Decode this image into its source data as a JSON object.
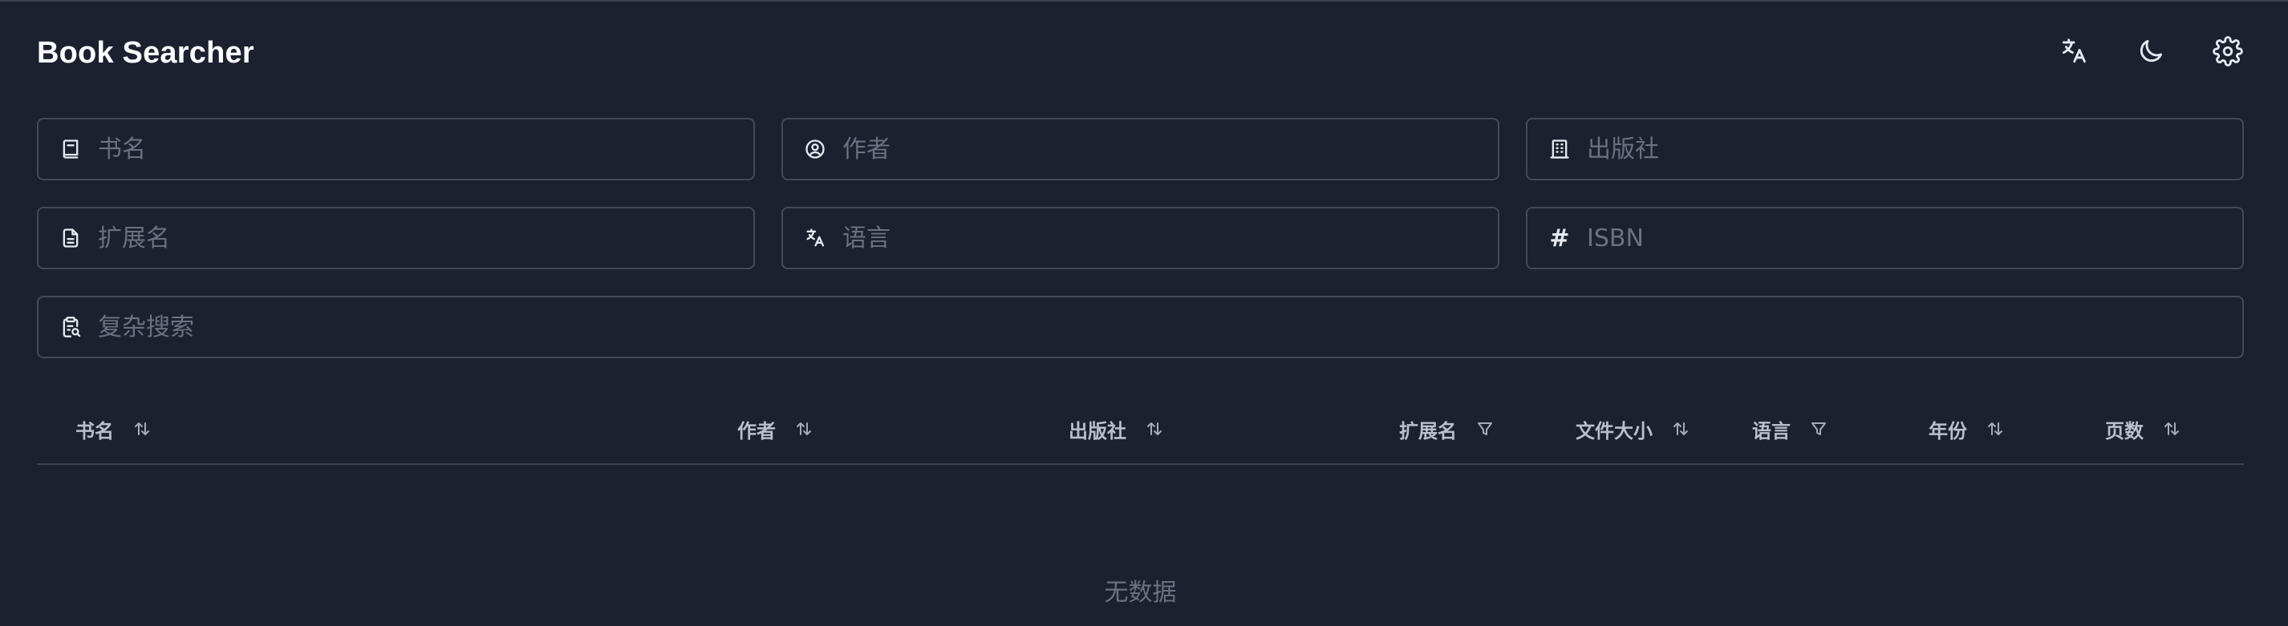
{
  "app": {
    "title": "Book Searcher"
  },
  "header": {
    "actions": [
      {
        "name": "language-icon"
      },
      {
        "name": "moon-icon"
      },
      {
        "name": "gear-icon"
      }
    ]
  },
  "search": {
    "fields": [
      {
        "key": "title",
        "icon": "book-icon",
        "placeholder": "书名",
        "value": ""
      },
      {
        "key": "author",
        "icon": "user-circle-icon",
        "placeholder": "作者",
        "value": ""
      },
      {
        "key": "publisher",
        "icon": "building-icon",
        "placeholder": "出版社",
        "value": ""
      },
      {
        "key": "extension",
        "icon": "file-icon",
        "placeholder": "扩展名",
        "value": ""
      },
      {
        "key": "language",
        "icon": "language-icon",
        "placeholder": "语言",
        "value": ""
      },
      {
        "key": "isbn",
        "icon": "hash-icon",
        "placeholder": "ISBN",
        "value": "",
        "glyph": "#"
      },
      {
        "key": "complex",
        "icon": "clipboard-search-icon",
        "placeholder": "复杂搜索",
        "value": ""
      }
    ]
  },
  "table": {
    "columns": [
      {
        "label": "书名",
        "control": "sort"
      },
      {
        "label": "作者",
        "control": "sort"
      },
      {
        "label": "出版社",
        "control": "sort"
      },
      {
        "label": "扩展名",
        "control": "filter"
      },
      {
        "label": "文件大小",
        "control": "sort"
      },
      {
        "label": "语言",
        "control": "filter"
      },
      {
        "label": "年份",
        "control": "sort"
      },
      {
        "label": "页数",
        "control": "sort"
      }
    ],
    "empty_text": "无数据"
  },
  "colors": {
    "background": "#1c2130",
    "border": "#434a59",
    "text": "#e6e9ef",
    "placeholder": "#6b7180"
  }
}
